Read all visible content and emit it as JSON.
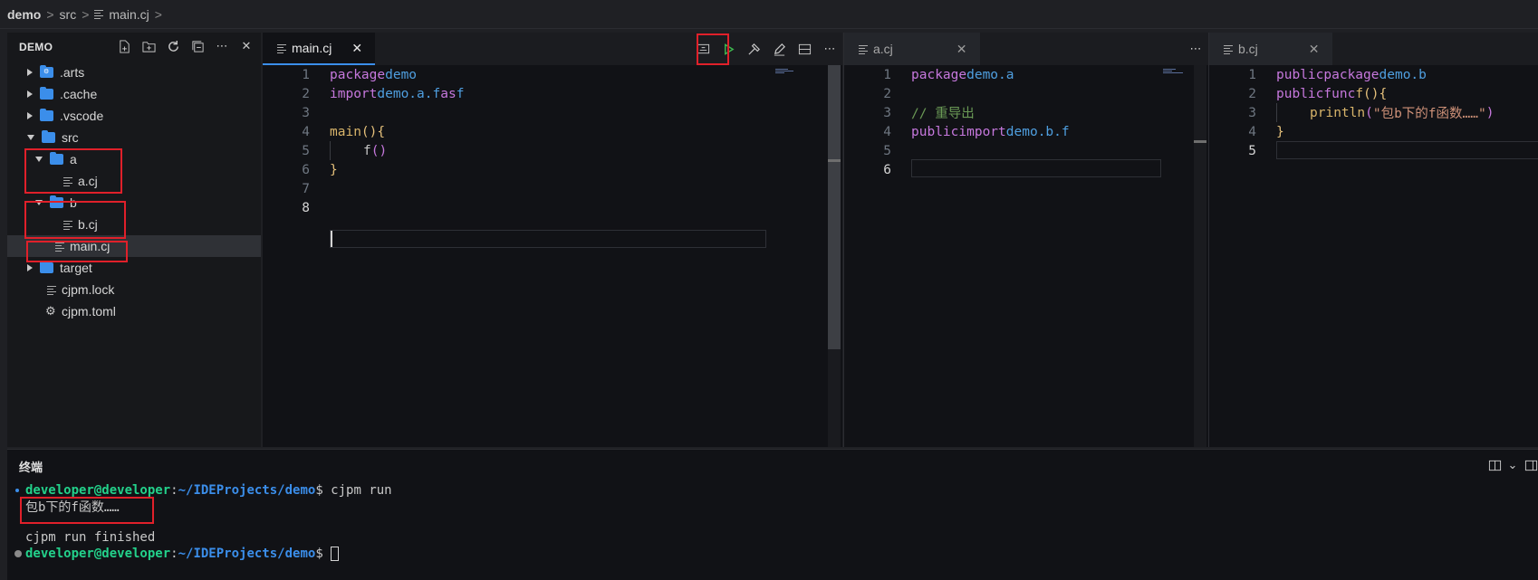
{
  "breadcrumb": {
    "root": "demo",
    "folder": "src",
    "file": "main.cj"
  },
  "explorer": {
    "title": "DEMO",
    "actions": [
      "new-file-icon",
      "new-folder-icon",
      "refresh-icon",
      "collapse-all-icon",
      "more-icon",
      "close-icon"
    ],
    "tree": [
      {
        "label": ".arts",
        "kind": "folder",
        "badge": "⚙",
        "state": "collapsed"
      },
      {
        "label": ".cache",
        "kind": "folder",
        "state": "collapsed"
      },
      {
        "label": ".vscode",
        "kind": "folder",
        "state": "collapsed"
      },
      {
        "label": "src",
        "kind": "folder",
        "state": "expanded"
      },
      {
        "label": "a",
        "kind": "folder",
        "state": "expanded"
      },
      {
        "label": "a.cj",
        "kind": "file"
      },
      {
        "label": "b",
        "kind": "folder",
        "state": "expanded"
      },
      {
        "label": "b.cj",
        "kind": "file"
      },
      {
        "label": "main.cj",
        "kind": "file",
        "selected": true
      },
      {
        "label": "target",
        "kind": "folder",
        "state": "collapsed"
      },
      {
        "label": "cjpm.lock",
        "kind": "file"
      },
      {
        "label": "cjpm.toml",
        "kind": "gear-file"
      }
    ]
  },
  "editors": {
    "main": {
      "tab": "main.cj",
      "lines": [
        "1",
        "2",
        "3",
        "4",
        "5",
        "6",
        "7",
        "8"
      ],
      "code": {
        "l1_kw": "package",
        "l1_id": "demo",
        "l2_kw": "import",
        "l2_id": "demo.a.f",
        "l2_as": "as",
        "l2_alias": "f",
        "l4_fn": "main",
        "l4_paren": "()",
        "l4_brace": "{",
        "l5_call": "f",
        "l5_paren": "()",
        "l6_brace": "}"
      }
    },
    "a": {
      "tab": "a.cj",
      "lines": [
        "1",
        "2",
        "3",
        "4",
        "5",
        "6"
      ],
      "code": {
        "l1_kw": "package",
        "l1_id": "demo.a",
        "l3_comment": "// 重导出",
        "l4_kw1": "public",
        "l4_kw2": "import",
        "l4_id": "demo.b.f"
      }
    },
    "b": {
      "tab": "b.cj",
      "lines": [
        "1",
        "2",
        "3",
        "4",
        "5"
      ],
      "code": {
        "l1_kw1": "public",
        "l1_kw2": "package",
        "l1_id": "demo.b",
        "l2_kw1": "public",
        "l2_kw2": "func",
        "l2_fn": "f",
        "l2_paren": "()",
        "l2_brace": "{",
        "l3_call": "println",
        "l3_open": "(",
        "l3_str": "\"包b下的f函数……\"",
        "l3_close": ")",
        "l4_brace": "}"
      }
    }
  },
  "terminal": {
    "title": "终端",
    "prompt_user": "developer@developer",
    "prompt_sep": ":",
    "prompt_path": "~/IDEProjects/demo",
    "prompt_end": "$",
    "command": " cjpm run",
    "output": "包b下的f函数……",
    "finished": "cjpm run finished",
    "colors": {
      "dot1": "#3b8eea",
      "dot2": "#8a8a8a"
    }
  }
}
